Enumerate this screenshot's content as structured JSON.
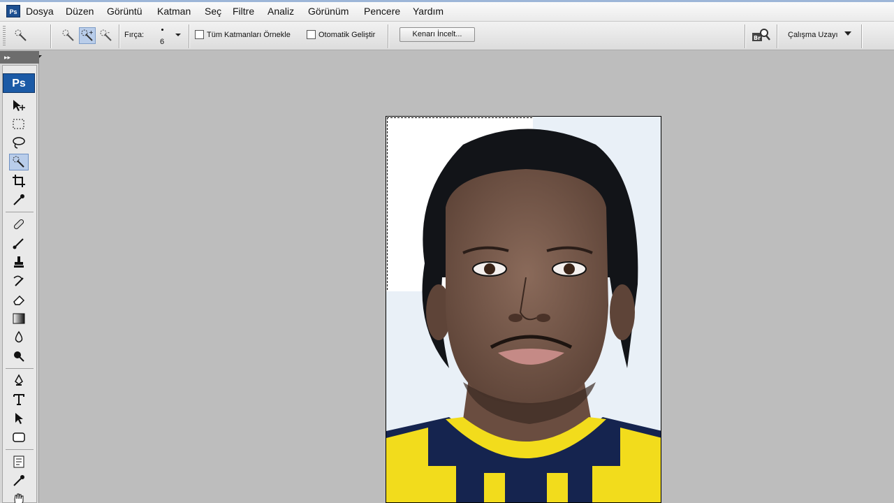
{
  "menu": [
    "Dosya",
    "Düzen",
    "Görüntü",
    "Katman",
    "Seç",
    "Filtre",
    "Analiz",
    "Görünüm",
    "Pencere",
    "Yardım"
  ],
  "app_logo": "Ps",
  "options": {
    "brush_label": "Fırça:",
    "brush_size": "6",
    "sample_all_layers": "Tüm Katmanları Örnekle",
    "auto_enhance": "Otomatik Geliştir",
    "refine_edge": "Kenarı İncelt...",
    "workspace": "Çalışma Uzayı"
  },
  "toolbox": {
    "collapse_glyph": "▸▸",
    "logo": "Ps",
    "icons": [
      "move-icon",
      "marquee-icon",
      "lasso-icon",
      "quick-selection-icon",
      "crop-icon",
      "eyedropper-icon",
      "healing-brush-icon",
      "brush-icon",
      "clone-stamp-icon",
      "history-brush-icon",
      "eraser-icon",
      "gradient-icon",
      "blur-icon",
      "dodge-icon",
      "pen-icon",
      "type-icon",
      "path-selection-icon",
      "shape-icon",
      "notes-icon",
      "color-sampler-icon",
      "hand-icon"
    ]
  },
  "colors": {
    "accent": "#1b5aa6",
    "canvas_bg": "#bdbdbd",
    "jersey_yellow": "#f2dc1c",
    "jersey_navy": "#15244f"
  }
}
